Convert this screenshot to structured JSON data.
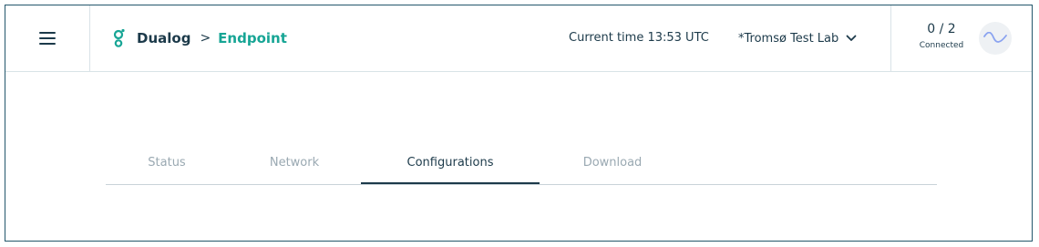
{
  "header": {
    "brand_name": "Dualog",
    "breadcrumb_sep": ">",
    "breadcrumb_current": "Endpoint",
    "current_time": "Current time 13:53 UTC",
    "site_selector": "*Tromsø Test Lab",
    "connection_count": "0 / 2",
    "connection_label": "Connected"
  },
  "tabs": [
    {
      "label": "Status"
    },
    {
      "label": "Network"
    },
    {
      "label": "Configurations"
    },
    {
      "label": "Download"
    }
  ],
  "active_tab": "Configurations",
  "colors": {
    "accent": "#17a595",
    "text": "#1c3a4a",
    "muted": "#9aa9b2",
    "border": "#23566b"
  },
  "icons": [
    "menu-icon",
    "dualog-logo-icon",
    "chevron-down-icon",
    "wave-icon"
  ]
}
